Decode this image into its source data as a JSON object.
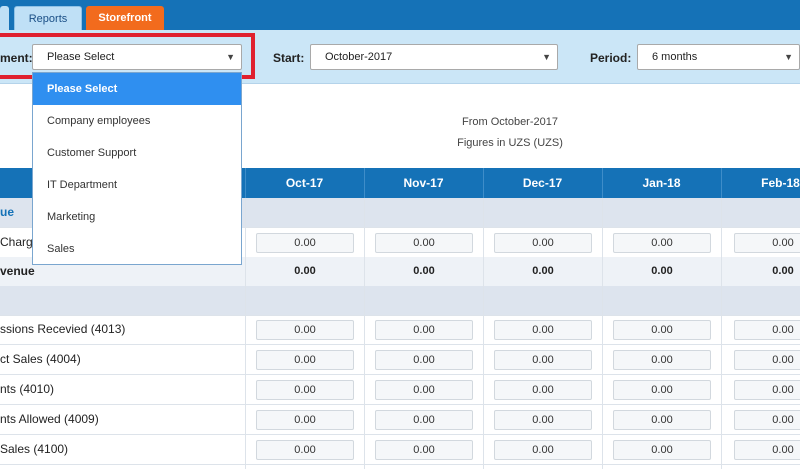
{
  "tabs": {
    "reports": "Reports",
    "storefront": "Storefront"
  },
  "toolbar": {
    "department_label": "ment:",
    "department_value": "Please Select",
    "start_label": "Start:",
    "start_value": "October-2017",
    "period_label": "Period:",
    "period_value": "6 months"
  },
  "dropdown": {
    "options": [
      "Please Select",
      "Company employees",
      "Customer Support",
      "IT Department",
      "Marketing",
      "Sales"
    ]
  },
  "report": {
    "from_text": "From October-2017",
    "figures_text": "Figures in UZS (UZS)"
  },
  "columns": [
    "Oct-17",
    "Nov-17",
    "Dec-17",
    "Jan-18",
    "Feb-18"
  ],
  "rows": [
    {
      "label": "ue",
      "type": "section"
    },
    {
      "label": "Charg",
      "type": "input",
      "values": [
        "0.00",
        "0.00",
        "0.00",
        "0.00",
        "0.00"
      ]
    },
    {
      "label": "venue",
      "type": "total",
      "values": [
        "0.00",
        "0.00",
        "0.00",
        "0.00",
        "0.00"
      ]
    },
    {
      "label": "",
      "type": "section"
    },
    {
      "label": "ssions Recevied (4013)",
      "type": "input",
      "values": [
        "0.00",
        "0.00",
        "0.00",
        "0.00",
        "0.00"
      ]
    },
    {
      "label": "ct Sales (4004)",
      "type": "input",
      "values": [
        "0.00",
        "0.00",
        "0.00",
        "0.00",
        "0.00"
      ]
    },
    {
      "label": "nts (4010)",
      "type": "input",
      "values": [
        "0.00",
        "0.00",
        "0.00",
        "0.00",
        "0.00"
      ]
    },
    {
      "label": "nts Allowed (4009)",
      "type": "input",
      "values": [
        "0.00",
        "0.00",
        "0.00",
        "0.00",
        "0.00"
      ]
    },
    {
      "label": "Sales (4100)",
      "type": "input",
      "values": [
        "0.00",
        "0.00",
        "0.00",
        "0.00",
        "0.00"
      ]
    }
  ]
}
